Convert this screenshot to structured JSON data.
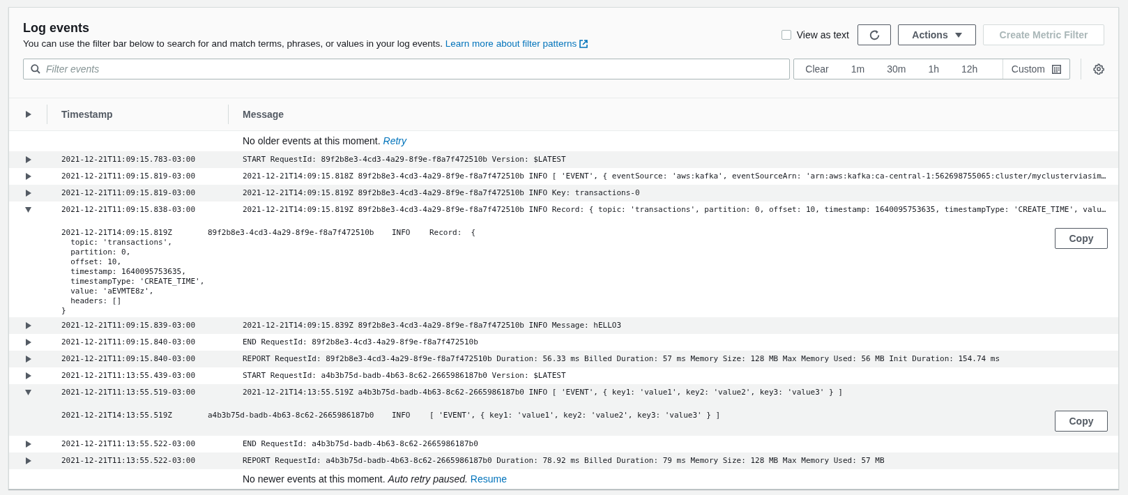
{
  "panel": {
    "title": "Log events",
    "description": "You can use the filter bar below to search for and match terms, phrases, or values in your log events.",
    "learn_more_link": "Learn more about filter patterns"
  },
  "view_as_text": {
    "label": "View as text",
    "checked": false
  },
  "actions_button": "Actions",
  "create_metric_filter": {
    "label": "Create Metric Filter",
    "disabled": true
  },
  "filter": {
    "placeholder": "Filter events"
  },
  "time_ranges": [
    {
      "label": "Clear",
      "kind": "preset"
    },
    {
      "label": "1m",
      "kind": "preset"
    },
    {
      "label": "30m",
      "kind": "preset"
    },
    {
      "label": "1h",
      "kind": "preset"
    },
    {
      "label": "12h",
      "kind": "preset"
    },
    {
      "label": "Custom",
      "kind": "custom"
    }
  ],
  "table": {
    "columns": [
      "Timestamp",
      "Message"
    ],
    "top_notice": {
      "text": "No older events at this moment.",
      "link": "Retry"
    },
    "rows": [
      {
        "timestamp": "2021-12-21T11:09:15.783-03:00",
        "message": "START RequestId: 89f2b8e3-4cd3-4a29-8f9e-f8a7f472510b Version: $LATEST",
        "expanded": false
      },
      {
        "timestamp": "2021-12-21T11:09:15.819-03:00",
        "message": "2021-12-21T14:09:15.818Z 89f2b8e3-4cd3-4a29-8f9e-f8a7f472510b INFO [ 'EVENT', { eventSource: 'aws:kafka', eventSourceArn: 'arn:aws:kafka:ca-central-1:562698755065:cluster/myclusterviasim…",
        "expanded": false
      },
      {
        "timestamp": "2021-12-21T11:09:15.819-03:00",
        "message": "2021-12-21T14:09:15.819Z 89f2b8e3-4cd3-4a29-8f9e-f8a7f472510b INFO Key: transactions-0",
        "expanded": false
      },
      {
        "timestamp": "2021-12-21T11:09:15.838-03:00",
        "message": "2021-12-21T14:09:15.819Z 89f2b8e3-4cd3-4a29-8f9e-f8a7f472510b INFO Record: { topic: 'transactions', partition: 0, offset: 10, timestamp: 1640095753635, timestampType: 'CREATE_TIME', valu…",
        "expanded": true,
        "detail": {
          "timestamp": "2021-12-21T14:09:15.819Z",
          "request_id": "89f2b8e3-4cd3-4a29-8f9e-f8a7f472510b",
          "level": "INFO",
          "message": "Record:  {",
          "continuation": [
            "  topic: 'transactions',",
            "  partition: 0,",
            "  offset: 10,",
            "  timestamp: 1640095753635,",
            "  timestampType: 'CREATE_TIME',",
            "  value: 'aEVMTE8z',",
            "  headers: []",
            "}"
          ],
          "copy_button": "Copy"
        }
      },
      {
        "timestamp": "2021-12-21T11:09:15.839-03:00",
        "message": "2021-12-21T14:09:15.839Z 89f2b8e3-4cd3-4a29-8f9e-f8a7f472510b INFO Message: hELLO3",
        "expanded": false
      },
      {
        "timestamp": "2021-12-21T11:09:15.840-03:00",
        "message": "END RequestId: 89f2b8e3-4cd3-4a29-8f9e-f8a7f472510b",
        "expanded": false
      },
      {
        "timestamp": "2021-12-21T11:09:15.840-03:00",
        "message": "REPORT RequestId: 89f2b8e3-4cd3-4a29-8f9e-f8a7f472510b Duration: 56.33 ms Billed Duration: 57 ms Memory Size: 128 MB Max Memory Used: 56 MB Init Duration: 154.74 ms",
        "expanded": false
      },
      {
        "timestamp": "2021-12-21T11:13:55.439-03:00",
        "message": "START RequestId: a4b3b75d-badb-4b63-8c62-2665986187b0 Version: $LATEST",
        "expanded": false
      },
      {
        "timestamp": "2021-12-21T11:13:55.519-03:00",
        "message": "2021-12-21T14:13:55.519Z a4b3b75d-badb-4b63-8c62-2665986187b0 INFO [ 'EVENT', { key1: 'value1', key2: 'value2', key3: 'value3' } ]",
        "expanded": true,
        "detail": {
          "timestamp": "2021-12-21T14:13:55.519Z",
          "request_id": "a4b3b75d-badb-4b63-8c62-2665986187b0",
          "level": "INFO",
          "message": "[ 'EVENT', { key1: 'value1', key2: 'value2', key3: 'value3' } ]",
          "copy_button": "Copy"
        }
      },
      {
        "timestamp": "2021-12-21T11:13:55.522-03:00",
        "message": "END RequestId: a4b3b75d-badb-4b63-8c62-2665986187b0",
        "expanded": false
      },
      {
        "timestamp": "2021-12-21T11:13:55.522-03:00",
        "message": "REPORT RequestId: a4b3b75d-badb-4b63-8c62-2665986187b0 Duration: 78.92 ms Billed Duration: 79 ms Memory Size: 128 MB Max Memory Used: 57 MB",
        "expanded": false
      }
    ],
    "bottom_notice": {
      "text": "No newer events at this moment.",
      "italic": "Auto retry paused.",
      "link": "Resume"
    }
  }
}
